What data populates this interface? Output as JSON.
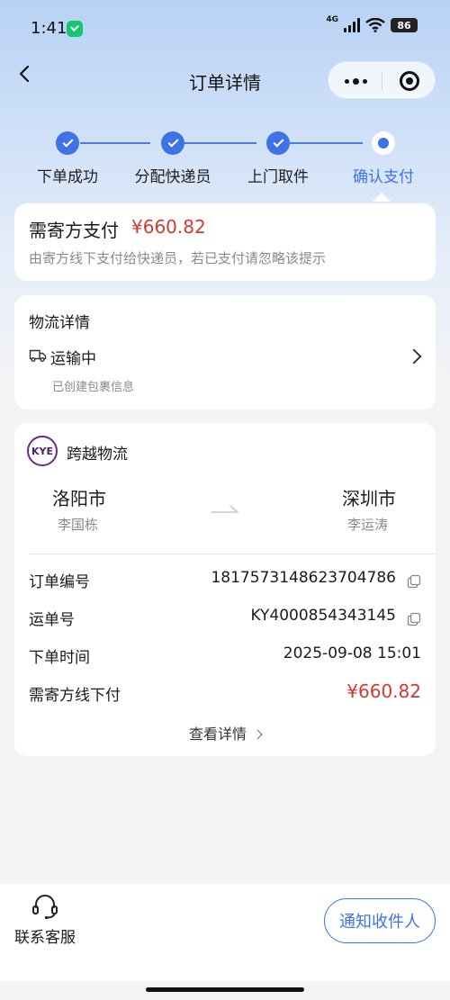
{
  "status_bar": {
    "time": "1:41",
    "network": "4G",
    "battery": "86"
  },
  "nav": {
    "title": "订单详情"
  },
  "steps": [
    {
      "label": "下单成功",
      "state": "done"
    },
    {
      "label": "分配快递员",
      "state": "done"
    },
    {
      "label": "上门取件",
      "state": "done"
    },
    {
      "label": "确认支付",
      "state": "current"
    }
  ],
  "payment": {
    "title": "需寄方支付",
    "amount": "¥660.82",
    "hint": "由寄方线下支付给快递员，若已支付请忽略该提示"
  },
  "logistics": {
    "title": "物流详情",
    "status": "运输中",
    "sub": "已创建包裹信息"
  },
  "order": {
    "carrier_logo_text": "KYE",
    "carrier": "跨越物流",
    "from_city": "洛阳市",
    "from_name": "李国栋",
    "to_city": "深圳市",
    "to_name": "李运涛",
    "rows": [
      {
        "label": "订单编号",
        "value": "1817573148623704786"
      },
      {
        "label": "运单号",
        "value": "KY4000854343145"
      },
      {
        "label": "下单时间",
        "value": "2025-09-08 15:01"
      },
      {
        "label": "需寄方线下付",
        "value": "¥660.82"
      }
    ],
    "view_detail": "查看详情"
  },
  "bottom": {
    "customer_service": "联系客服",
    "notify_button": "通知收件人"
  },
  "colors": {
    "accent": "#3d73e6",
    "price": "#d03a31"
  }
}
